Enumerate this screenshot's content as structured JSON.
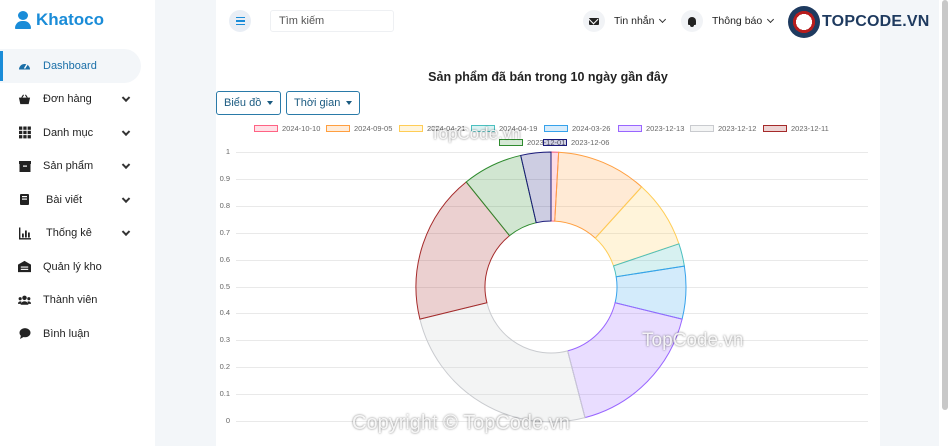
{
  "brand": {
    "name": "Khatoco",
    "icon": "user-icon"
  },
  "sidebar": {
    "items": [
      {
        "label": "Dashboard",
        "icon": "gauge-icon",
        "active": true,
        "has_submenu": false
      },
      {
        "label": "Đơn hàng",
        "icon": "basket-icon",
        "has_submenu": true
      },
      {
        "label": "Danh mục",
        "icon": "grid-icon",
        "has_submenu": true
      },
      {
        "label": "Sản phẩm",
        "icon": "box-icon",
        "has_submenu": true
      },
      {
        "label": "Bài viết",
        "icon": "book-icon",
        "has_submenu": true
      },
      {
        "label": "Thống kê",
        "icon": "chart-icon",
        "has_submenu": true
      },
      {
        "label": "Quản lý kho",
        "icon": "warehouse-icon",
        "has_submenu": false
      },
      {
        "label": "Thành viên",
        "icon": "users-icon",
        "has_submenu": false
      },
      {
        "label": "Bình luận",
        "icon": "comment-icon",
        "has_submenu": false
      }
    ]
  },
  "header": {
    "search_placeholder": "Tìm kiếm",
    "messages_label": "Tin nhắn",
    "notifications_label": "Thông báo"
  },
  "logo": {
    "text": "TOPCODE.VN"
  },
  "controls": {
    "chart_type_label": "Biểu đồ",
    "time_label": "Thời gian"
  },
  "chart_data": {
    "type": "doughnut",
    "title": "Sản phẩm đã bán trong 10 ngày gần đây",
    "labels": [
      "2024-10-10",
      "2024-09-05",
      "2024-04-21",
      "2024-04-19",
      "2024-03-26",
      "2023-12-13",
      "2023-12-12",
      "2023-12-11",
      "2023-12-01",
      "2023-12-06"
    ],
    "values": [
      1,
      12,
      9,
      3,
      7,
      19,
      28,
      20,
      8,
      4
    ],
    "colors": [
      "#ff6384",
      "#ff9f40",
      "#ffcd56",
      "#4bc0c0",
      "#36a2eb",
      "#9966ff",
      "#c9cbcf",
      "#a52a2a",
      "#2e8b2e",
      "#1a1a7a"
    ],
    "yaxis_ticks": [
      "1",
      "0.9",
      "0.8",
      "0.7",
      "0.6",
      "0.5",
      "0.4",
      "0.3",
      "0.2",
      "0.1",
      "0"
    ],
    "grid": true,
    "legend": "top"
  },
  "watermarks": [
    "TopCode.vn",
    "TopCode.vn",
    "Copyright © TopCode.vn"
  ]
}
